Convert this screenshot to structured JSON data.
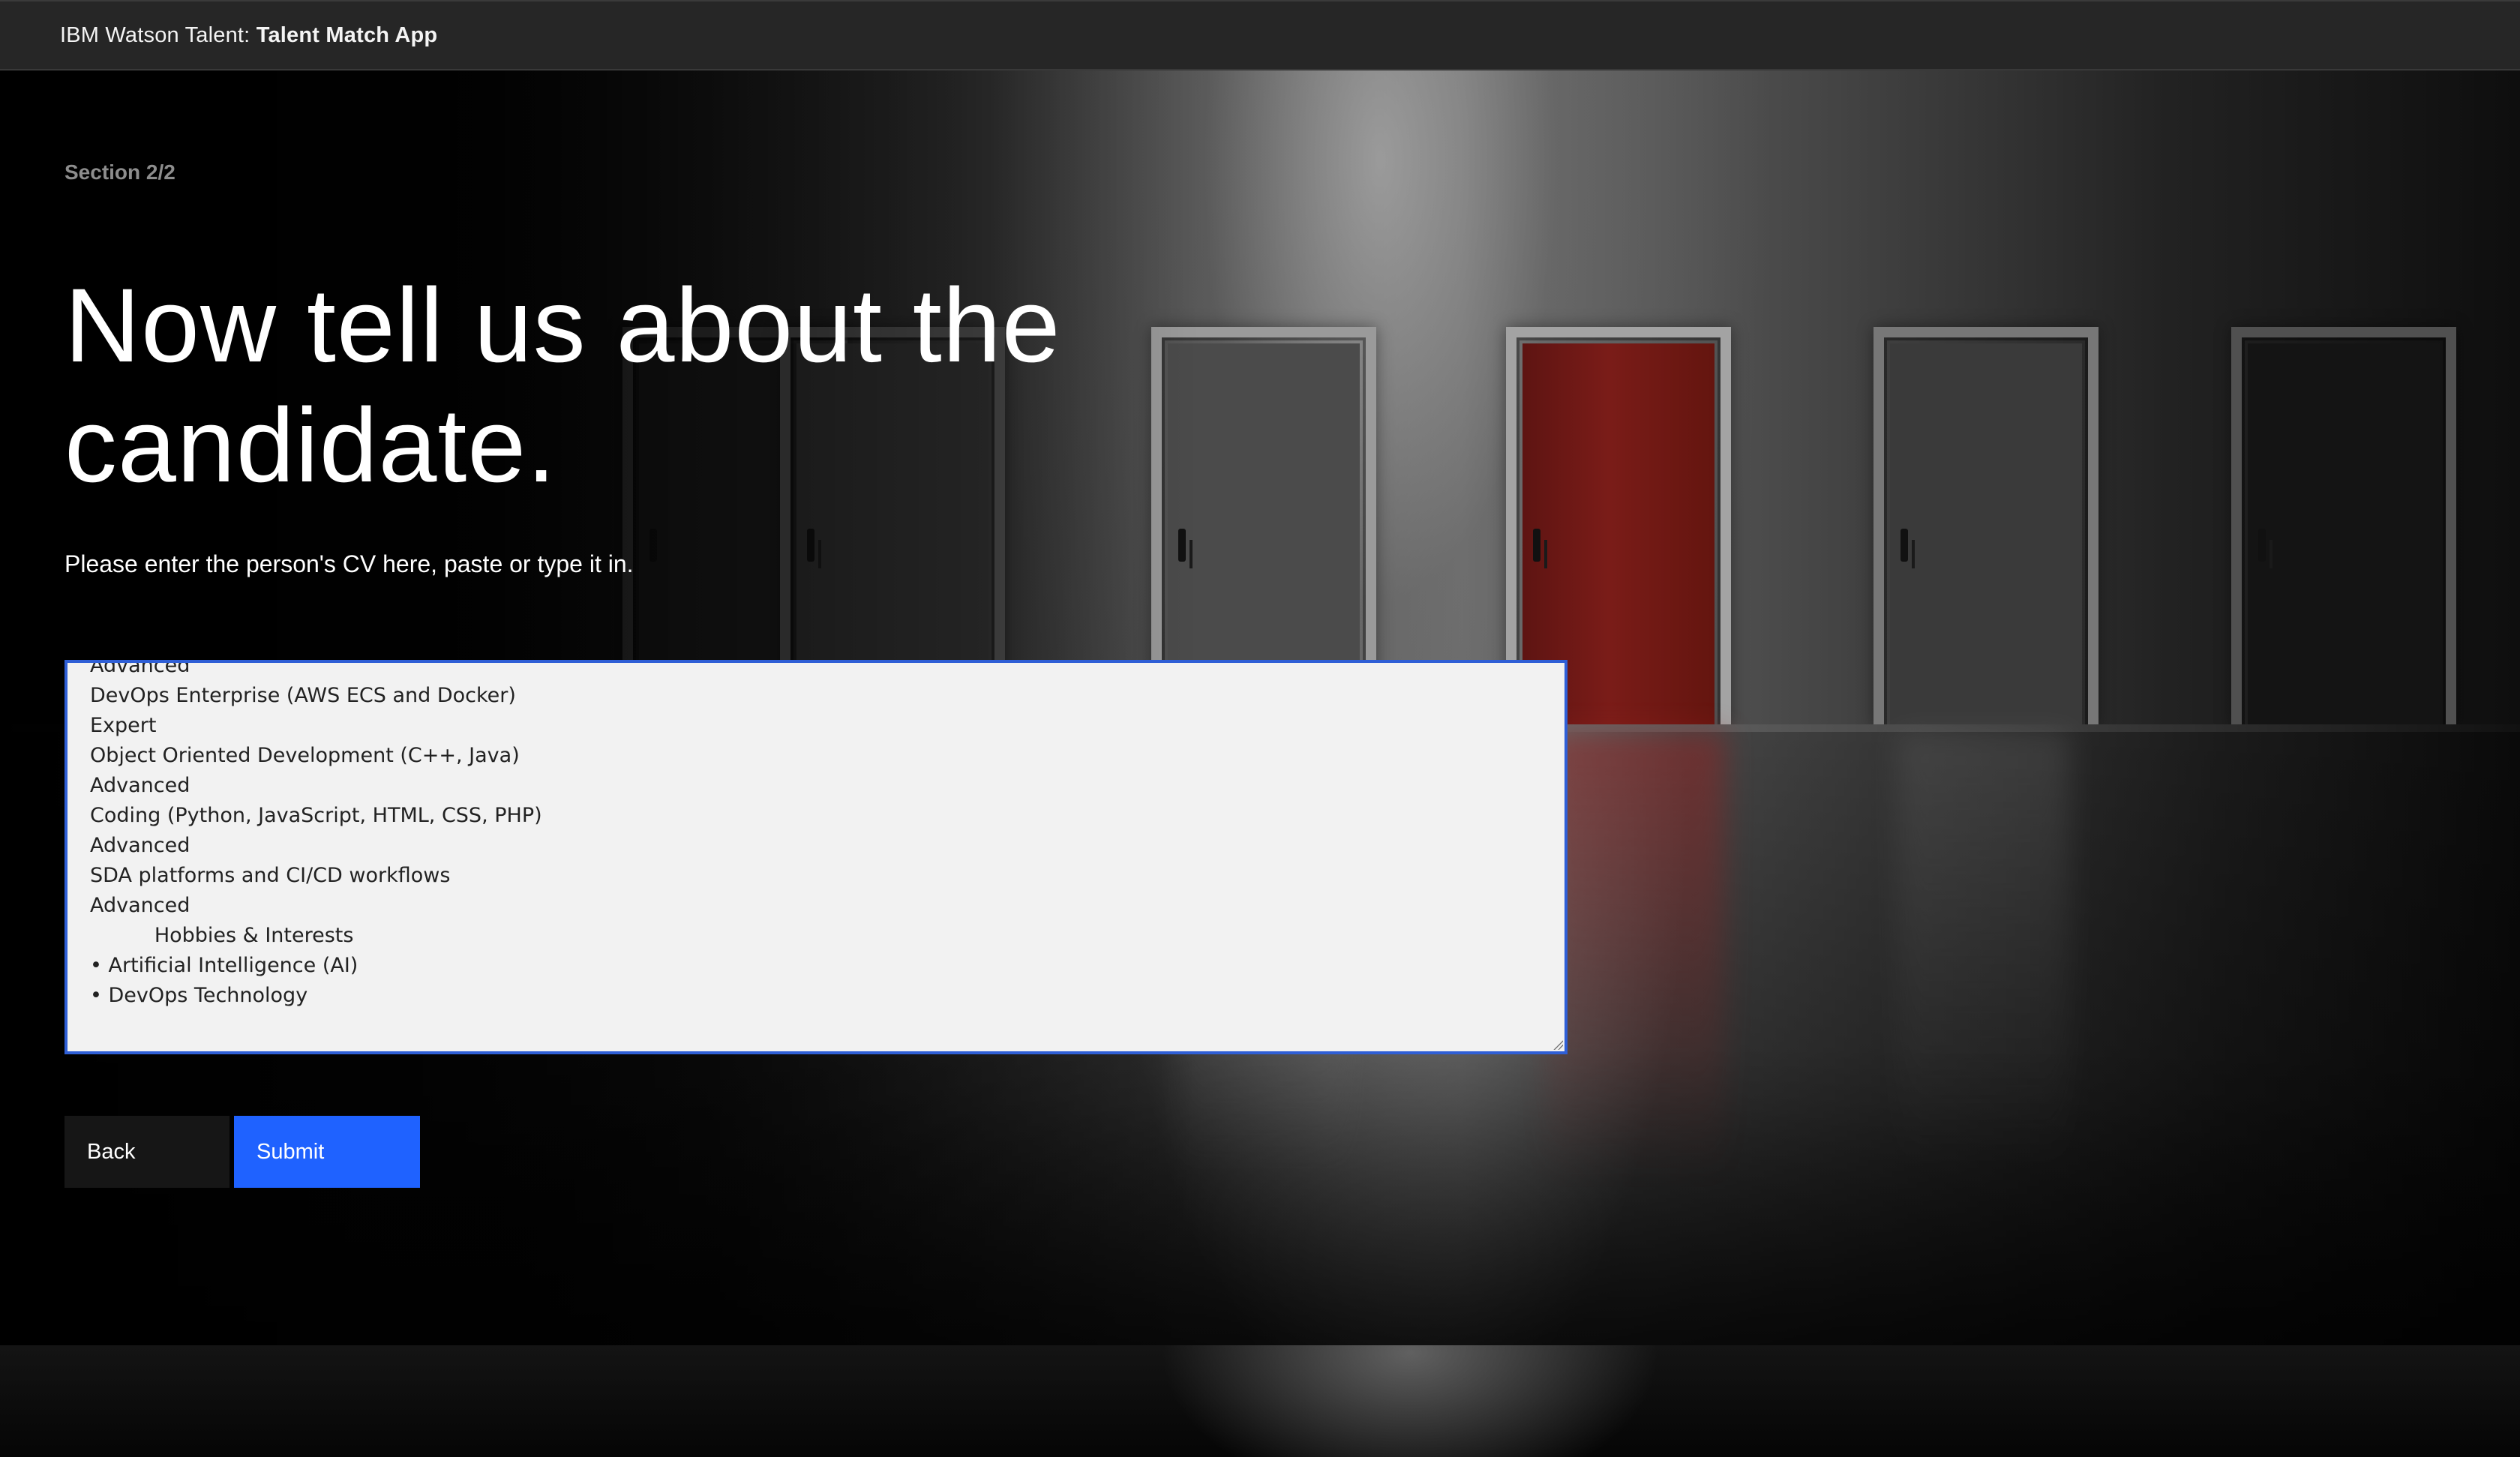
{
  "header": {
    "brand_prefix": "IBM Watson Talent:",
    "app_name": "Talent Match App"
  },
  "form": {
    "section_label": "Section 2/2",
    "heading": "Now tell us about the candidate.",
    "instruction": "Please enter the person's CV here, paste or type it in.",
    "cv_text_lines": [
      "Advanced",
      "DevOps Enterprise (AWS ECS and Docker)",
      "Expert",
      "Object Oriented Development (C++, Java)",
      "Advanced",
      "Coding (Python, JavaScript, HTML, CSS, PHP)",
      "Advanced",
      "SDA platforms and CI/CD workflows",
      "Advanced",
      "          Hobbies & Interests",
      "• Artificial Intelligence (AI)",
      "• DevOps Technology"
    ],
    "back_label": "Back",
    "submit_label": "Submit"
  },
  "colors": {
    "header_bg": "#262626",
    "primary_button": "#1f62ff",
    "secondary_button": "#161616",
    "textarea_border": "#2f5fd6",
    "textarea_bg": "#f2f2f2"
  }
}
